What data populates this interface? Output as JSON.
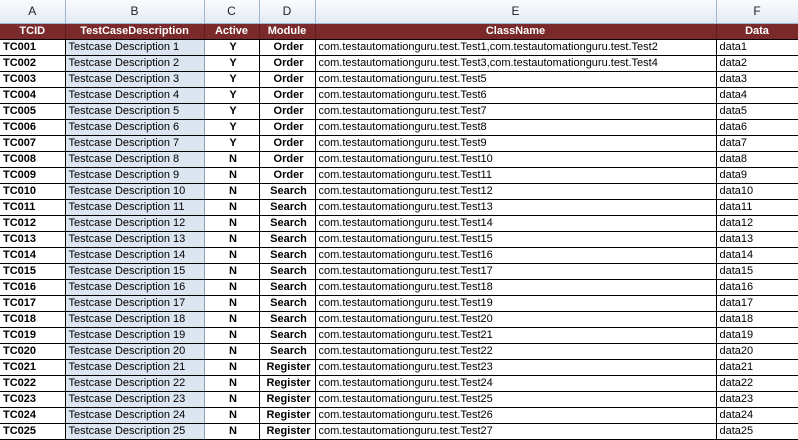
{
  "column_letters": [
    "A",
    "B",
    "C",
    "D",
    "E",
    "F"
  ],
  "headers": [
    "TCID",
    "TestCaseDescription",
    "Active",
    "Module",
    "ClassName",
    "Data"
  ],
  "rows": [
    {
      "id": "TC001",
      "desc": "Testcase Description 1",
      "active": "Y",
      "module": "Order",
      "class": "com.testautomationguru.test.Test1,com.testautomationguru.test.Test2",
      "data": "data1"
    },
    {
      "id": "TC002",
      "desc": "Testcase Description 2",
      "active": "Y",
      "module": "Order",
      "class": "com.testautomationguru.test.Test3,com.testautomationguru.test.Test4",
      "data": "data2"
    },
    {
      "id": "TC003",
      "desc": "Testcase Description 3",
      "active": "Y",
      "module": "Order",
      "class": "com.testautomationguru.test.Test5",
      "data": "data3"
    },
    {
      "id": "TC004",
      "desc": "Testcase Description 4",
      "active": "Y",
      "module": "Order",
      "class": "com.testautomationguru.test.Test6",
      "data": "data4"
    },
    {
      "id": "TC005",
      "desc": "Testcase Description 5",
      "active": "Y",
      "module": "Order",
      "class": "com.testautomationguru.test.Test7",
      "data": "data5"
    },
    {
      "id": "TC006",
      "desc": "Testcase Description 6",
      "active": "Y",
      "module": "Order",
      "class": "com.testautomationguru.test.Test8",
      "data": "data6"
    },
    {
      "id": "TC007",
      "desc": "Testcase Description 7",
      "active": "Y",
      "module": "Order",
      "class": "com.testautomationguru.test.Test9",
      "data": "data7"
    },
    {
      "id": "TC008",
      "desc": "Testcase Description 8",
      "active": "N",
      "module": "Order",
      "class": "com.testautomationguru.test.Test10",
      "data": "data8"
    },
    {
      "id": "TC009",
      "desc": "Testcase Description 9",
      "active": "N",
      "module": "Order",
      "class": "com.testautomationguru.test.Test11",
      "data": "data9"
    },
    {
      "id": "TC010",
      "desc": "Testcase Description 10",
      "active": "N",
      "module": "Search",
      "class": "com.testautomationguru.test.Test12",
      "data": "data10"
    },
    {
      "id": "TC011",
      "desc": "Testcase Description 11",
      "active": "N",
      "module": "Search",
      "class": "com.testautomationguru.test.Test13",
      "data": "data11"
    },
    {
      "id": "TC012",
      "desc": "Testcase Description 12",
      "active": "N",
      "module": "Search",
      "class": "com.testautomationguru.test.Test14",
      "data": "data12"
    },
    {
      "id": "TC013",
      "desc": "Testcase Description 13",
      "active": "N",
      "module": "Search",
      "class": "com.testautomationguru.test.Test15",
      "data": "data13"
    },
    {
      "id": "TC014",
      "desc": "Testcase Description 14",
      "active": "N",
      "module": "Search",
      "class": "com.testautomationguru.test.Test16",
      "data": "data14"
    },
    {
      "id": "TC015",
      "desc": "Testcase Description 15",
      "active": "N",
      "module": "Search",
      "class": "com.testautomationguru.test.Test17",
      "data": "data15"
    },
    {
      "id": "TC016",
      "desc": "Testcase Description 16",
      "active": "N",
      "module": "Search",
      "class": "com.testautomationguru.test.Test18",
      "data": "data16"
    },
    {
      "id": "TC017",
      "desc": "Testcase Description 17",
      "active": "N",
      "module": "Search",
      "class": "com.testautomationguru.test.Test19",
      "data": "data17"
    },
    {
      "id": "TC018",
      "desc": "Testcase Description 18",
      "active": "N",
      "module": "Search",
      "class": "com.testautomationguru.test.Test20",
      "data": "data18"
    },
    {
      "id": "TC019",
      "desc": "Testcase Description 19",
      "active": "N",
      "module": "Search",
      "class": "com.testautomationguru.test.Test21",
      "data": "data19"
    },
    {
      "id": "TC020",
      "desc": "Testcase Description 20",
      "active": "N",
      "module": "Search",
      "class": "com.testautomationguru.test.Test22",
      "data": "data20"
    },
    {
      "id": "TC021",
      "desc": "Testcase Description 21",
      "active": "N",
      "module": "Register",
      "class": "com.testautomationguru.test.Test23",
      "data": "data21"
    },
    {
      "id": "TC022",
      "desc": "Testcase Description 22",
      "active": "N",
      "module": "Register",
      "class": "com.testautomationguru.test.Test24",
      "data": "data22"
    },
    {
      "id": "TC023",
      "desc": "Testcase Description 23",
      "active": "N",
      "module": "Register",
      "class": "com.testautomationguru.test.Test25",
      "data": "data23"
    },
    {
      "id": "TC024",
      "desc": "Testcase Description 24",
      "active": "N",
      "module": "Register",
      "class": "com.testautomationguru.test.Test26",
      "data": "data24"
    },
    {
      "id": "TC025",
      "desc": "Testcase Description 25",
      "active": "N",
      "module": "Register",
      "class": "com.testautomationguru.test.Test27",
      "data": "data25"
    }
  ]
}
